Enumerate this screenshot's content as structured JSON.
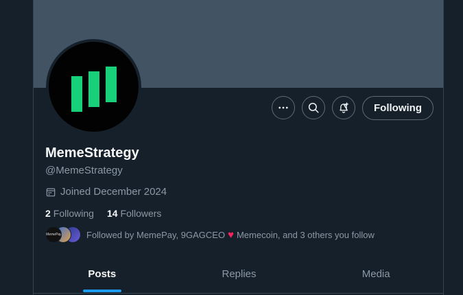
{
  "profile": {
    "display_name": "MemeStrategy",
    "handle": "@MemeStrategy",
    "joined": "Joined December 2024"
  },
  "actions": {
    "more_icon": "more-horizontal-icon",
    "search_icon": "search-icon",
    "notify_icon": "bell-plus-icon",
    "follow_label": "Following"
  },
  "stats": {
    "following_count": "2",
    "following_label": "Following",
    "followers_count": "14",
    "followers_label": "Followers"
  },
  "followed_by": {
    "prefix": "Followed by ",
    "names": "MemePay, 9GAGCEO",
    "heart": "♥",
    "rest": "Memecoin, and 3 others you follow",
    "avatar_label": "MemePay"
  },
  "tabs": [
    {
      "label": "Posts",
      "active": true
    },
    {
      "label": "Replies",
      "active": false
    },
    {
      "label": "Media",
      "active": false
    }
  ],
  "colors": {
    "background": "#15202b",
    "banner": "#425464",
    "accent": "#1d9bf0",
    "logo_green": "#18cf7a",
    "heart": "#f4245e"
  }
}
